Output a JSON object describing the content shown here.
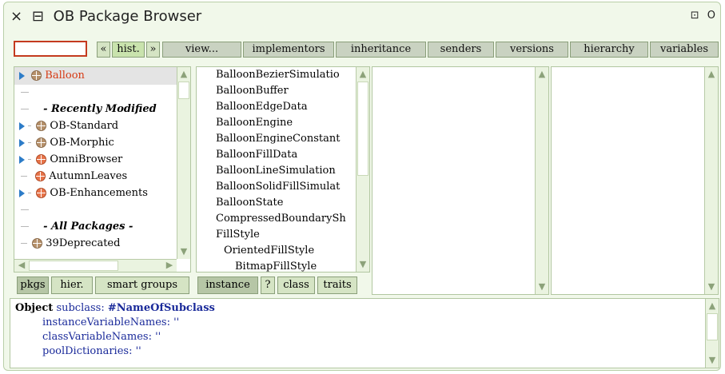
{
  "window": {
    "title": "OB Package Browser",
    "close_glyph": "×",
    "menu_glyph": "⊟",
    "collapse_glyph": "⊡",
    "expand_glyph": "O"
  },
  "toolbar": {
    "search_value": "",
    "back_label": "«",
    "hist_label": "hist.",
    "forward_label": "»",
    "buttons": [
      "view...",
      "implementors",
      "inheritance",
      "senders",
      "versions",
      "hierarchy",
      "variables"
    ]
  },
  "packages_pane": {
    "items": [
      {
        "label": "Balloon",
        "expandable": true,
        "icon": "package-icon",
        "selected": true
      },
      {
        "label": "",
        "expandable": false,
        "icon": "",
        "selected": false
      },
      {
        "label": "- Recently Modified",
        "expandable": false,
        "icon": "",
        "selected": false,
        "header": true
      },
      {
        "label": "OB-Standard",
        "expandable": true,
        "icon": "package-icon",
        "selected": false
      },
      {
        "label": "OB-Morphic",
        "expandable": true,
        "icon": "package-icon",
        "selected": false
      },
      {
        "label": "OmniBrowser",
        "expandable": true,
        "icon": "monticello-package-icon",
        "selected": false
      },
      {
        "label": "AutumnLeaves",
        "expandable": false,
        "icon": "monticello-package-icon",
        "selected": false
      },
      {
        "label": "OB-Enhancements",
        "expandable": true,
        "icon": "monticello-package-icon",
        "selected": false
      },
      {
        "label": "",
        "expandable": false,
        "icon": "",
        "selected": false
      },
      {
        "label": "- All Packages -",
        "expandable": false,
        "icon": "",
        "selected": false,
        "header": true
      },
      {
        "label": "39Deprecated",
        "expandable": false,
        "icon": "package-icon",
        "selected": false
      }
    ],
    "tabs": [
      "pkgs",
      "hier.",
      "smart groups"
    ]
  },
  "classes_pane": {
    "items": [
      "BalloonBezierSimulatio",
      "BalloonBuffer",
      "BalloonEdgeData",
      "BalloonEngine",
      "BalloonEngineConstant",
      "BalloonFillData",
      "BalloonLineSimulation",
      "BalloonSolidFillSimulat",
      "BalloonState",
      "CompressedBoundarySh",
      "FillStyle",
      "  OrientedFillStyle",
      "    BitmapFillStyle"
    ],
    "tabs": [
      "instance",
      "?",
      "class",
      "traits"
    ]
  },
  "code_pane": {
    "lines": [
      {
        "kw": "Object",
        "rest": " subclass: ",
        "sym": "#NameOfSubclass"
      },
      {
        "kw": "",
        "rest": "instanceVariableNames: ''",
        "sym": ""
      },
      {
        "kw": "",
        "rest": "classVariableNames: ''",
        "sym": ""
      },
      {
        "kw": "",
        "rest": "poolDictionaries: ''",
        "sym": ""
      }
    ]
  },
  "colors": {
    "window_bg": "#f1f8ea",
    "selected_label": "#d63a14",
    "button_bg": "#d5e4c4",
    "active_tab_bg": "#b6c6a6",
    "code_text": "#1a2a9a"
  }
}
